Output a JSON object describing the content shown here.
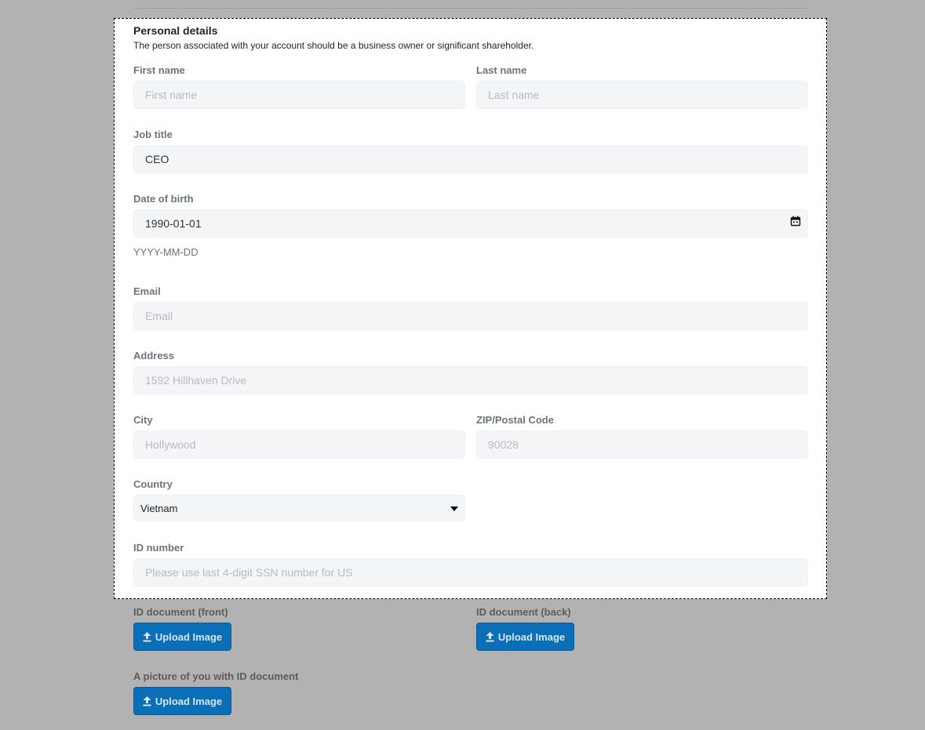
{
  "section": {
    "title": "Personal details",
    "subtitle": "The person associated with your account should be a business owner or significant shareholder."
  },
  "fields": {
    "first_name": {
      "label": "First name",
      "placeholder": "First name",
      "value": ""
    },
    "last_name": {
      "label": "Last name",
      "placeholder": "Last name",
      "value": ""
    },
    "job_title": {
      "label": "Job title",
      "placeholder": "",
      "value": "CEO"
    },
    "date_of_birth": {
      "label": "Date of birth",
      "value": "1990-01-01",
      "hint": "YYYY-MM-DD"
    },
    "email": {
      "label": "Email",
      "placeholder": "Email",
      "value": ""
    },
    "address": {
      "label": "Address",
      "placeholder": "1592 Hillhaven Drive",
      "value": ""
    },
    "city": {
      "label": "City",
      "placeholder": "Hollywood",
      "value": ""
    },
    "zip": {
      "label": "ZIP/Postal Code",
      "placeholder": "90028",
      "value": ""
    },
    "country": {
      "label": "Country",
      "selected": "Vietnam"
    },
    "id_number": {
      "label": "ID number",
      "placeholder": "Please use last 4-digit SSN number for US",
      "value": ""
    }
  },
  "uploads": {
    "front": {
      "label": "ID document (front)",
      "button": "Upload Image"
    },
    "back": {
      "label": "ID document (back)",
      "button": "Upload Image"
    },
    "selfie": {
      "label": "A picture of you with ID document",
      "button": "Upload Image"
    }
  },
  "icons": {
    "calendar": "calendar-icon",
    "upload": "upload-icon",
    "dropdown": "chevron-down-icon"
  },
  "colors": {
    "overlay": "#b2b2b2",
    "field_bg": "#f4f5f7",
    "button_bg": "#0a6fb6",
    "label": "#6c757d"
  }
}
